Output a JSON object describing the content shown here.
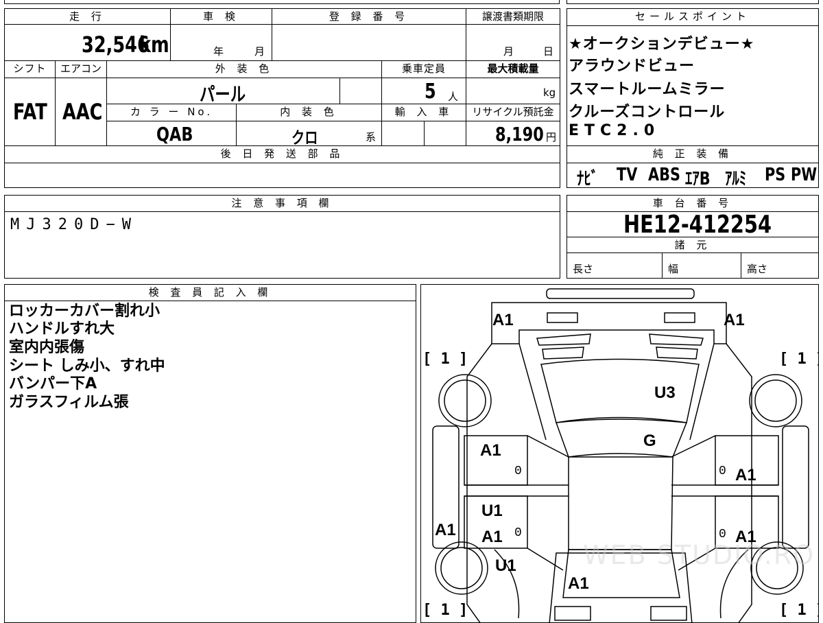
{
  "mileage": {
    "label": "走 行",
    "value": "32,546",
    "unit": "km"
  },
  "shaken": {
    "label": "車 検",
    "year_unit": "年",
    "month_unit": "月"
  },
  "registration": {
    "label": "登 録 番 号",
    "value": ""
  },
  "transfer_deadline": {
    "label": "譲渡書類期限",
    "month_unit": "月",
    "day_unit": "日"
  },
  "sales_points": {
    "label": "セールスポイント",
    "items": [
      "★オークションデビュー★",
      "アラウンドビュー",
      "スマートルームミラー",
      "クルーズコントロール",
      "ETC2.0"
    ]
  },
  "shift": {
    "label": "シフト",
    "value": "FAT"
  },
  "aircon": {
    "label": "エアコン",
    "value": "AAC"
  },
  "exterior_color": {
    "label": "外 装 色",
    "value": "パール"
  },
  "capacity": {
    "label": "乗車定員",
    "value": "5",
    "unit": "人"
  },
  "max_load": {
    "label": "最大積載量",
    "unit": "kg"
  },
  "color_no": {
    "label": "カ ラ ー No.",
    "value": "QAB"
  },
  "interior_color": {
    "label": "内 装 色",
    "value": "クロ",
    "unit": "系"
  },
  "import": {
    "label": "輸 入 車"
  },
  "recycle_fee": {
    "label": "リサイクル預託金",
    "value": "8,190",
    "unit": "円"
  },
  "later_parts": {
    "label": "後 日 発 送 部 品"
  },
  "genuine_equipment": {
    "label": "純 正 装 備",
    "items": [
      "ﾅﾋﾞ",
      "TV",
      "ABS",
      "ｴｱB",
      "ｱﾙﾐ",
      "PS",
      "PW"
    ]
  },
  "notes": {
    "label": "注 意 事 項 欄",
    "value": "MJ320D−W"
  },
  "chassis": {
    "label": "車 台 番 号",
    "value": "HE12-412254"
  },
  "specs": {
    "label": "諸 元",
    "length": "長さ",
    "width": "幅",
    "height": "高さ"
  },
  "inspector": {
    "label": "検 査 員 記 入 欄",
    "lines": [
      "ロッカーカバー割れ小",
      "ハンドルすれ大",
      "室内内張傷",
      "シート しみ小、すれ中",
      "バンパー下A",
      "ガラスフィルム張"
    ]
  },
  "diagram": {
    "front_left": "A1",
    "front_right": "A1",
    "bracket_tl": "[ 1 ]",
    "bracket_tr": "[ 1 ]",
    "bracket_bl": "[ 1 ]",
    "bracket_br": "[ 1 ]",
    "roof": "U3",
    "glass": "G",
    "left_front_door": "A1",
    "left_front_door_zero": "0",
    "left_rear_door_a": "U1",
    "left_rear_door_b": "A1",
    "left_rear_door_zero": "0",
    "left_rocker": "A1",
    "left_rear_fender": "U1",
    "right_front_door": "A1",
    "right_front_door_zero": "0",
    "right_rear_door": "A1",
    "right_rear_door_zero": "0",
    "trunk": "A1",
    "watermark": "WEB STUDIO.RO"
  }
}
